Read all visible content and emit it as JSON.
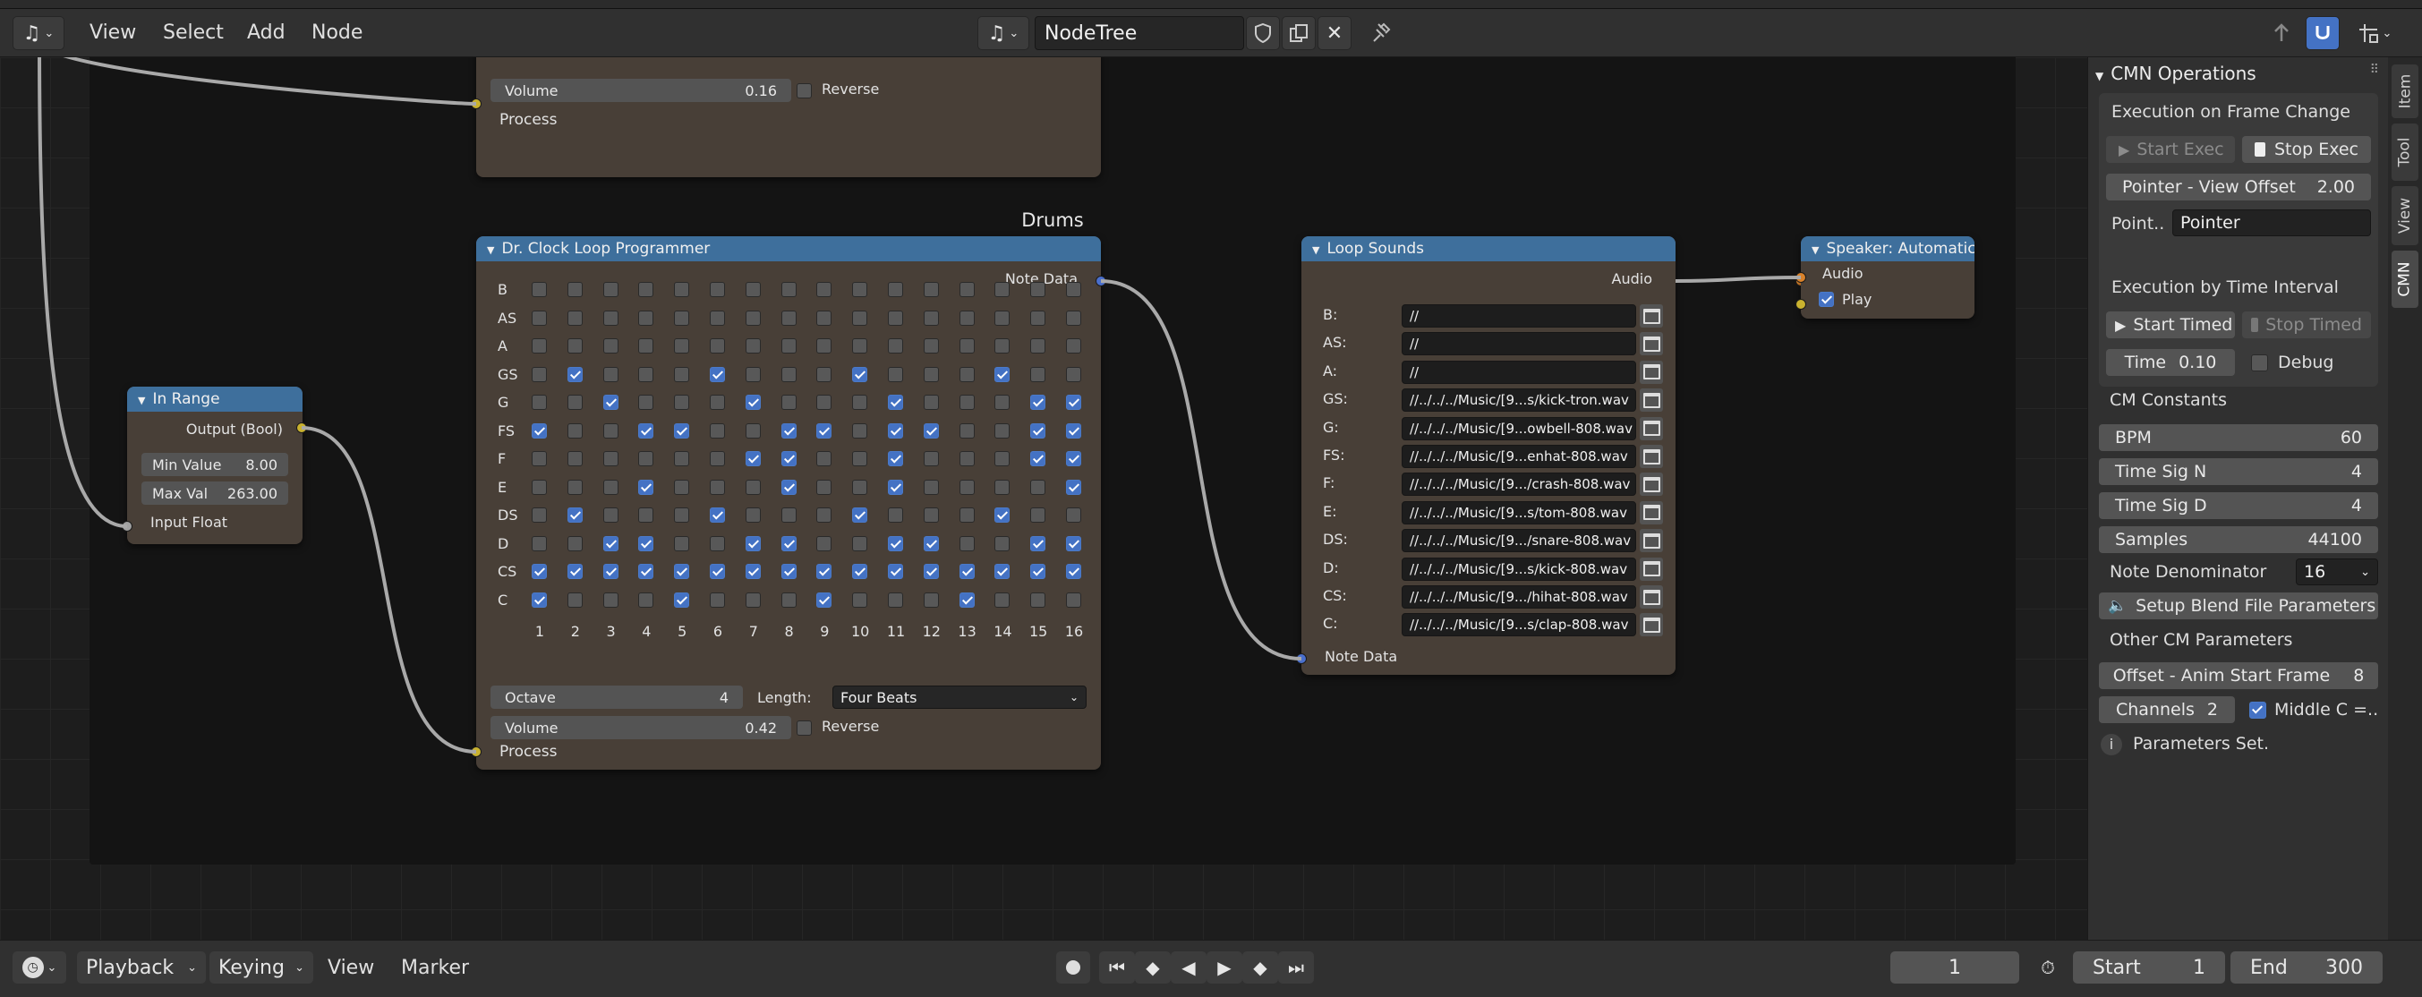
{
  "header": {
    "editor_icon": "music-note-icon",
    "menus": [
      "View",
      "Select",
      "Add",
      "Node"
    ],
    "tree_name": "NodeTree"
  },
  "frames": {
    "top_label": "",
    "drums": "Drums"
  },
  "top_node": {
    "volume_label": "Volume",
    "volume_value": "0.16",
    "reverse_label": "Reverse",
    "reverse_checked": false,
    "process_label": "Process"
  },
  "in_range": {
    "title": "In Range",
    "output_label": "Output (Bool)",
    "min_label": "Min Value",
    "min_value": "8.00",
    "max_label": "Max Val",
    "max_value": "263.00",
    "input_label": "Input Float"
  },
  "loop_programmer": {
    "title": "Dr. Clock Loop Programmer",
    "output_label": "Note Data",
    "rows": [
      "B",
      "AS",
      "A",
      "GS",
      "G",
      "FS",
      "F",
      "E",
      "DS",
      "D",
      "CS",
      "C"
    ],
    "columns": [
      "1",
      "2",
      "3",
      "4",
      "5",
      "6",
      "7",
      "8",
      "9",
      "10",
      "11",
      "12",
      "13",
      "14",
      "15",
      "16"
    ],
    "grid": [
      "0000000000000000",
      "0000000000000000",
      "0000000000000000",
      "0100010001000100",
      "0010001000100011",
      "1001100110110011",
      "0000001100100011",
      "0001000100100001",
      "0100010001000100",
      "0011001100110011",
      "1111111111111111",
      "1000100010001000"
    ],
    "octave_label": "Octave",
    "octave_value": "4",
    "length_label": "Length:",
    "length_value": "Four Beats",
    "volume_label": "Volume",
    "volume_value": "0.42",
    "reverse_label": "Reverse",
    "reverse_checked": false,
    "process_label": "Process"
  },
  "loop_sounds": {
    "title": "Loop Sounds",
    "output_label": "Audio",
    "input_label": "Note Data",
    "rows": [
      {
        "note": "B:",
        "path": "//"
      },
      {
        "note": "AS:",
        "path": "//"
      },
      {
        "note": "A:",
        "path": "//"
      },
      {
        "note": "GS:",
        "path": "//../../../Music/[9...s/kick-tron.wav"
      },
      {
        "note": "G:",
        "path": "//../../../Music/[9...owbell-808.wav"
      },
      {
        "note": "FS:",
        "path": "//../../../Music/[9...enhat-808.wav"
      },
      {
        "note": "F:",
        "path": "//../../../Music/[9.../crash-808.wav"
      },
      {
        "note": "E:",
        "path": "//../../../Music/[9...s/tom-808.wav"
      },
      {
        "note": "DS:",
        "path": "//../../../Music/[9.../snare-808.wav"
      },
      {
        "note": "D:",
        "path": "//../../../Music/[9...s/kick-808.wav"
      },
      {
        "note": "CS:",
        "path": "//../../../Music/[9.../hihat-808.wav"
      },
      {
        "note": "C:",
        "path": "//../../../Music/[9...s/clap-808.wav"
      }
    ]
  },
  "speaker": {
    "title": "Speaker: Automatic",
    "audio_label": "Audio",
    "play_label": "Play",
    "play_checked": true
  },
  "sidebar": {
    "panel_title": "CMN Operations",
    "tabs": [
      "Item",
      "Tool",
      "View",
      "CMN"
    ],
    "frame_change": {
      "title": "Execution on Frame Change",
      "start": "Start Exec",
      "stop": "Stop Exec",
      "offset_label": "Pointer - View Offset",
      "offset_value": "2.00",
      "pointer_label": "Point..",
      "pointer_value": "Pointer"
    },
    "time_interval": {
      "title": "Execution by Time Interval",
      "start": "Start Timed",
      "stop": "Stop Timed",
      "time_label": "Time",
      "time_value": "0.10",
      "debug_label": "Debug",
      "debug_checked": false
    },
    "constants": {
      "title": "CM Constants",
      "bpm_label": "BPM",
      "bpm_value": "60",
      "sign_label": "Time Sig N",
      "sign_value": "4",
      "sigd_label": "Time Sig D",
      "sigd_value": "4",
      "samples_label": "Samples",
      "samples_value": "44100",
      "note_den_label": "Note Denominator",
      "note_den_value": "16",
      "setup_button": "Setup Blend File Parameters"
    },
    "other": {
      "title": "Other CM Parameters",
      "offset_label": "Offset - Anim Start Frame",
      "offset_value": "8",
      "channels_label": "Channels",
      "channels_value": "2",
      "middlec_label": "Middle C =..",
      "middlec_checked": true,
      "status": "Parameters Set."
    }
  },
  "timeline": {
    "menus": [
      "Playback",
      "Keying",
      "View",
      "Marker"
    ],
    "current_frame": "1",
    "start_label": "Start",
    "start_value": "1",
    "end_label": "End",
    "end_value": "300"
  },
  "colors": {
    "node_header": "#3e6f9c",
    "node_body": "#483f37",
    "socket_yellow": "#c9b22f",
    "socket_blue": "#4a6fcc",
    "socket_orange": "#d9822b",
    "socket_gray": "#a1a1a1",
    "checkbox_on": "#4472c4"
  }
}
